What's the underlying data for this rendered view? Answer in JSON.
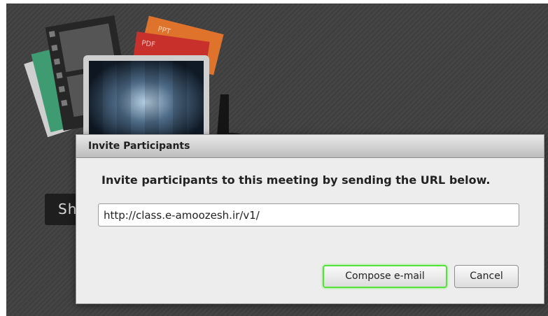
{
  "background": {
    "share_button_label": "Sh",
    "file_tags": [
      "PPT",
      "PDF"
    ]
  },
  "dialog": {
    "title": "Invite Participants",
    "message": "Invite participants to this meeting by sending the URL below.",
    "url_value": "http://class.e-amoozesh.ir/v1/",
    "compose_label": "Compose e-mail",
    "cancel_label": "Cancel"
  },
  "colors": {
    "focus_ring": "#55e23a",
    "stage_background": "#3f3f3f"
  }
}
